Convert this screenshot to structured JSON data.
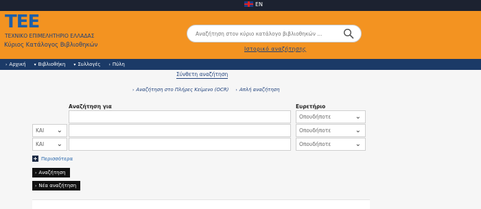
{
  "topbar": {
    "lang": "EN"
  },
  "header": {
    "logo": "TEE",
    "org": "ΤΕΧΝΙΚΟ ΕΠΙΜΕΛΗΤΗΡΙΟ ΕΛΛΑΔΑΣ",
    "catalog": "Κύριος Κατάλογος Βιβλιοθηκών",
    "search_placeholder": "Αναζήτηση στον κύριο κατάλογο βιβλιοθηκών ...",
    "advanced_link": "Ιστορικό αναζήτησης"
  },
  "nav": {
    "items": [
      {
        "label": "Αρχική",
        "caret": "›"
      },
      {
        "label": "Βιβλιοθήκη",
        "caret": "▾"
      },
      {
        "label": "Συλλογές",
        "caret": "▾"
      },
      {
        "label": "Πύλη",
        "caret": "›"
      }
    ]
  },
  "main": {
    "title": "Σύνθετη αναζήτηση",
    "link_ocr": "Αναζήτηση στο Πλήρες Κείμενο (OCR)",
    "link_simple": "Απλή αναζήτηση",
    "search_for_label": "Αναζήτηση για",
    "index_label": "Ευρετήριο",
    "rows": [
      {
        "operator": "",
        "index": "Οπουδήποτε"
      },
      {
        "operator": "ΚΑΙ",
        "index": "Οπουδήποτε"
      },
      {
        "operator": "ΚΑΙ",
        "index": "Οπουδήποτε"
      }
    ],
    "more": "Περισσότερα",
    "search_button": "Αναζήτηση",
    "new_search_button": "Νέα αναζήτηση"
  }
}
